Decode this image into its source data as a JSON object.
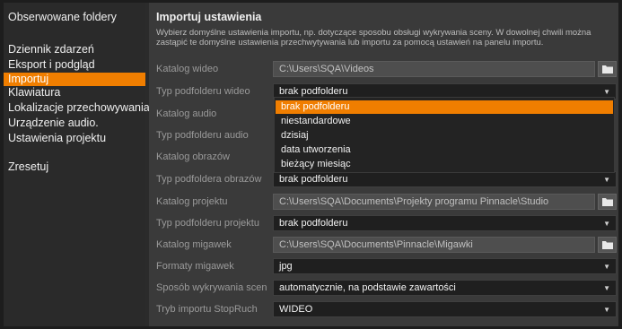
{
  "sidebar": {
    "header": "Obserwowane foldery",
    "items": [
      {
        "label": "Dziennik zdarzeń",
        "active": false
      },
      {
        "label": "Eksport i podgląd",
        "active": false
      },
      {
        "label": "Importuj",
        "active": true
      },
      {
        "label": "Klawiatura",
        "active": false
      },
      {
        "label": "Lokalizacje przechowywania",
        "active": false
      },
      {
        "label": "Urządzenie audio.",
        "active": false
      },
      {
        "label": "Ustawienia projektu",
        "active": false
      }
    ],
    "reset_label": "Zresetuj"
  },
  "panel": {
    "title": "Importuj ustawienia",
    "description": "Wybierz domyślne ustawienia importu, np. dotyczące sposobu obsługi wykrywania sceny. W dowolnej chwili można zastąpić te domyślne ustawienia przechwytywania lub importu za pomocą ustawień na panelu importu.",
    "rows": {
      "video_folder": {
        "label": "Katalog wideo",
        "value": "C:\\Users\\SQA\\Videos"
      },
      "video_subfolder": {
        "label": "Typ podfolderu wideo",
        "value": "brak podfolderu"
      },
      "audio_folder": {
        "label": "Katalog audio"
      },
      "audio_subfolder": {
        "label": "Typ podfolderu audio"
      },
      "image_folder": {
        "label": "Katalog obrazów"
      },
      "image_subfolder": {
        "label": "Typ podfoldera obrazów",
        "value": "brak podfolderu"
      },
      "project_folder": {
        "label": "Katalog projektu",
        "value": "C:\\Users\\SQA\\Documents\\Projekty programu Pinnacle\\Studio"
      },
      "project_subfolder": {
        "label": "Typ podfolderu projektu",
        "value": "brak podfolderu"
      },
      "snapshot_folder": {
        "label": "Katalog migawek",
        "value": "C:\\Users\\SQA\\Documents\\Pinnacle\\Migawki"
      },
      "snapshot_format": {
        "label": "Formaty migawek",
        "value": "jpg"
      },
      "scene_detection": {
        "label": "Sposób wykrywania scen",
        "value": "automatycznie, na podstawie zawartości"
      },
      "stopmotion_mode": {
        "label": "Tryb importu StopRuch",
        "value": "WIDEO"
      }
    }
  },
  "dropdown": {
    "options": [
      {
        "label": "brak podfolderu",
        "selected": true
      },
      {
        "label": "niestandardowe",
        "selected": false
      },
      {
        "label": "dzisiaj",
        "selected": false
      },
      {
        "label": "data utworzenia",
        "selected": false
      },
      {
        "label": "bieżący miesiąc",
        "selected": false
      }
    ]
  },
  "icons": {
    "folder": "folder-icon",
    "dropdown_arrow": "triangle-down-icon"
  },
  "colors": {
    "accent": "#f07e00",
    "panel_bg": "#3a3a3a",
    "sidebar_bg": "#2a2a2a"
  }
}
